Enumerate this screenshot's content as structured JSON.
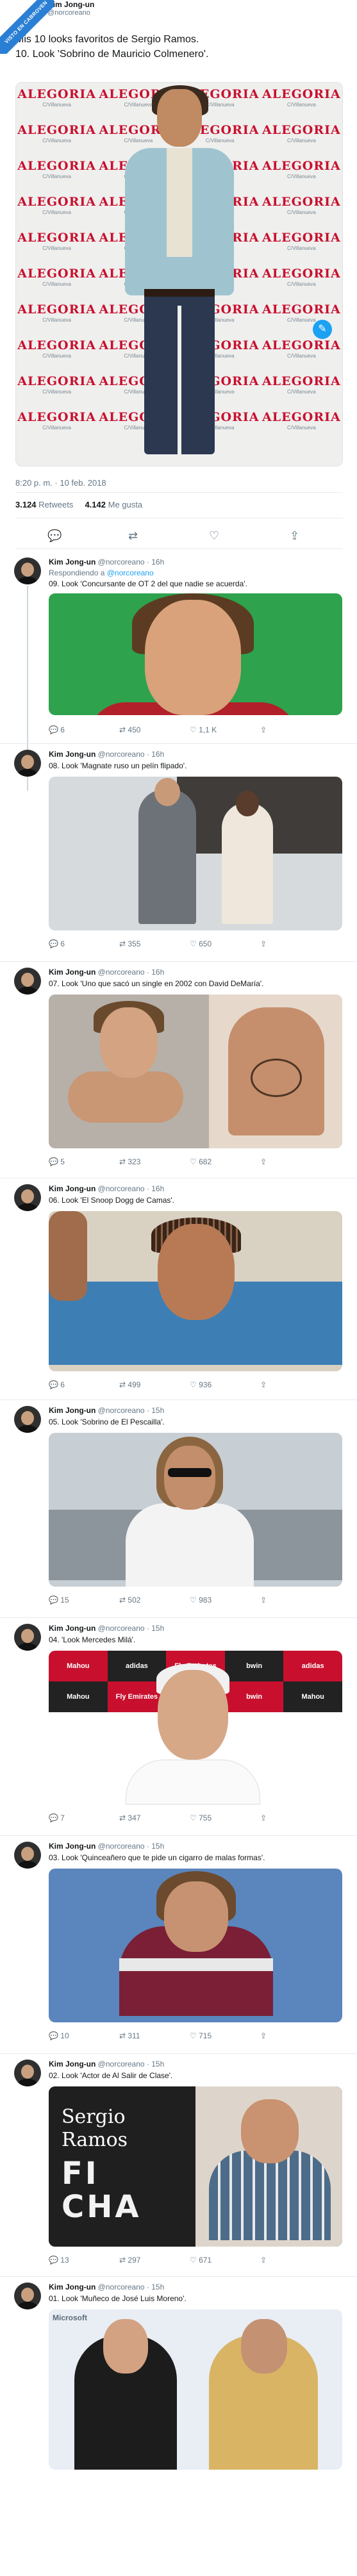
{
  "badge": {
    "text": "VISTO EN CABROVEN"
  },
  "tweet": {
    "name": "Kim Jong-un",
    "handle": "@norcoreano",
    "text": "Mis 10 looks favoritos de Sergio Ramos.\n10. Look 'Sobrino de Mauricio Colmenero'.",
    "sponsor_logo": "ALEGORIA",
    "sponsor_sub": "C/Villanueva",
    "time": "8:20 p. m. · 10 feb. 2018",
    "retweets": "3.124",
    "retweets_label": "Retweets",
    "likes": "4.142",
    "likes_label": "Me gusta"
  },
  "icons": {
    "reply": "reply-icon",
    "retweet": "retweet-icon",
    "like": "heart-icon",
    "share": "share-icon"
  },
  "replies": [
    {
      "name": "Kim Jong-un",
      "handle": "@norcoreano",
      "time": "16h",
      "in_reply": "Respondiendo a",
      "in_reply_handle": "@norcoreano",
      "text": "09. Look 'Concursante de OT 2 del que nadie se acuerda'.",
      "replies": "6",
      "retweets": "450",
      "likes": "1,1 K"
    },
    {
      "name": "Kim Jong-un",
      "handle": "@norcoreano",
      "time": "16h",
      "text": "08. Look 'Magnate ruso un pelín flipado'.",
      "replies": "6",
      "retweets": "355",
      "likes": "650"
    },
    {
      "name": "Kim Jong-un",
      "handle": "@norcoreano",
      "time": "16h",
      "text": "07. Look 'Uno que sacó un single en 2002 con David DeMaría'.",
      "replies": "5",
      "retweets": "323",
      "likes": "682"
    },
    {
      "name": "Kim Jong-un",
      "handle": "@norcoreano",
      "time": "16h",
      "text": "06. Look 'El Snoop Dogg de Camas'.",
      "replies": "6",
      "retweets": "499",
      "likes": "936"
    },
    {
      "name": "Kim Jong-un",
      "handle": "@norcoreano",
      "time": "15h",
      "text": "05. Look 'Sobrino de El Pescailla'.",
      "replies": "15",
      "retweets": "502",
      "likes": "983"
    },
    {
      "name": "Kim Jong-un",
      "handle": "@norcoreano",
      "time": "15h",
      "text": "04. 'Look Mercedes Milá'.",
      "replies": "7",
      "retweets": "347",
      "likes": "755",
      "board": [
        "Mahou",
        "adidas",
        "Fly Emirates",
        "bwin",
        "adidas",
        "Mahou",
        "Fly Emirates",
        "adidas",
        "bwin",
        "Mahou"
      ]
    },
    {
      "name": "Kim Jong-un",
      "handle": "@norcoreano",
      "time": "15h",
      "text": "03. Look 'Quinceañero que te pide un cigarro de malas formas'.",
      "replies": "10",
      "retweets": "311",
      "likes": "715"
    },
    {
      "name": "Kim Jong-un",
      "handle": "@norcoreano",
      "time": "15h",
      "text": "02. Look 'Actor de Al Salir de Clase'.",
      "replies": "13",
      "retweets": "297",
      "likes": "671",
      "poster_title": "Sergio\nRamos",
      "poster_big": "FI\nCHA"
    },
    {
      "name": "Kim Jong-un",
      "handle": "@norcoreano",
      "time": "15h",
      "text": "01. Look 'Muñeco de José Luis Moreno'.",
      "ms": "Microsoft"
    }
  ]
}
